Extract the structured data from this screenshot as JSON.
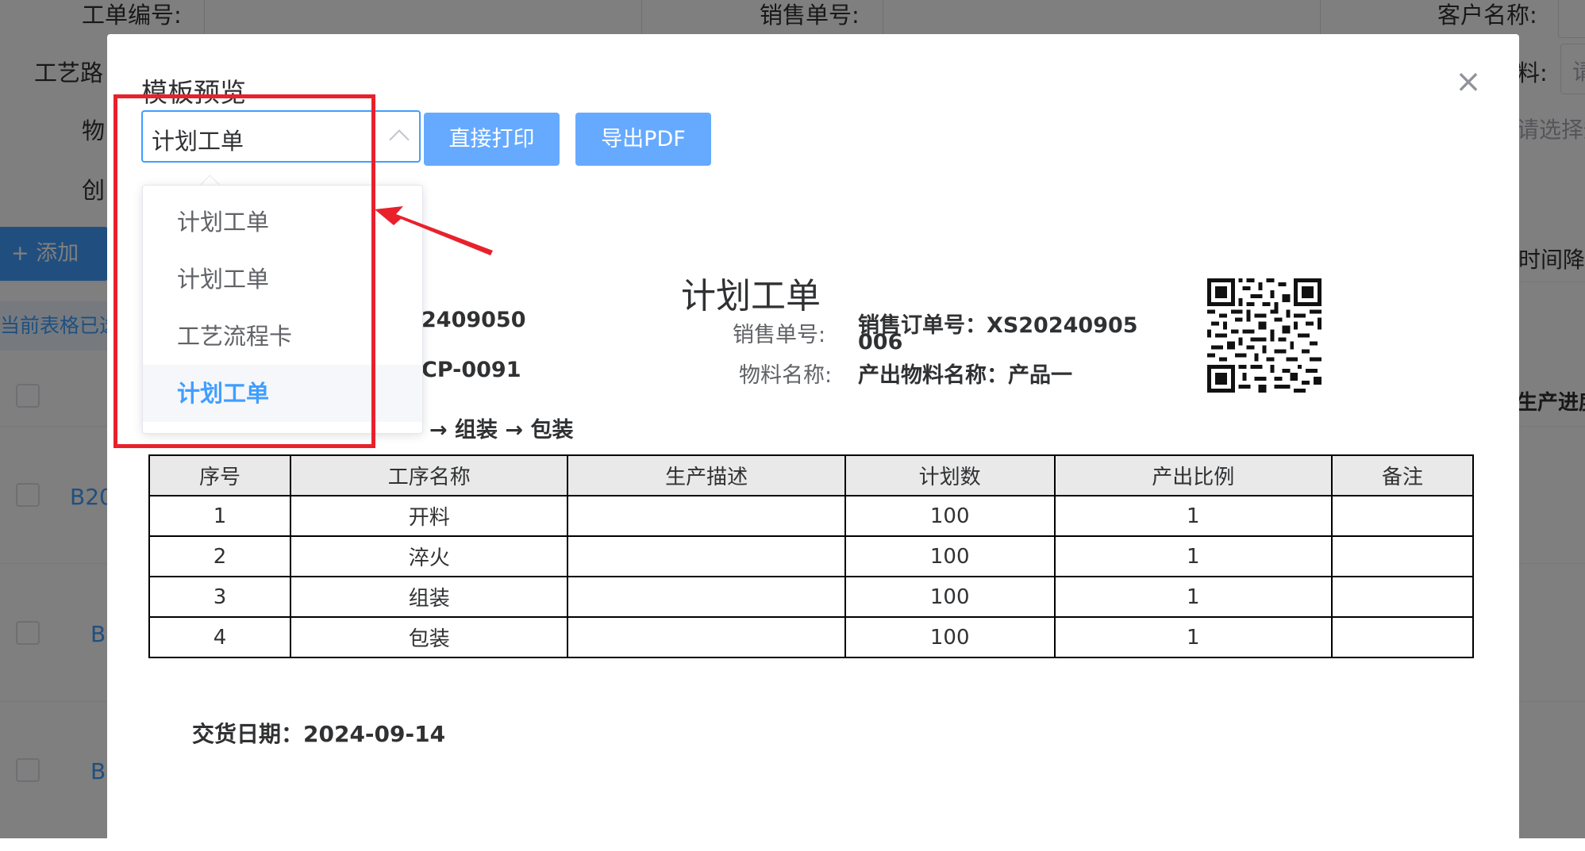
{
  "background": {
    "filters": {
      "order_no_label": "工单编号:",
      "sales_no_label": "销售单号:",
      "customer_label": "客户名称:",
      "route_label": "工艺路",
      "material_label": "物",
      "creator_label": "创",
      "material_right_label": "料:",
      "input_placeholder_right": "请",
      "select_spec_placeholder": "请选择规"
    },
    "add_button": "+ 添加",
    "table_tip": "当前表格已选",
    "time_col": "时间降",
    "progress_col": "生产进度",
    "rows": [
      "B20",
      "B",
      "B"
    ]
  },
  "dialog": {
    "title": "模板预览",
    "template_select_value": "计划工单",
    "print_button": "直接打印",
    "export_button": "导出PDF",
    "dropdown_options": [
      {
        "label": "计划工单",
        "selected": false
      },
      {
        "label": "计划工单",
        "selected": false
      },
      {
        "label": "工艺流程卡",
        "selected": false
      },
      {
        "label": "计划工单",
        "selected": true
      }
    ]
  },
  "preview": {
    "title": "计划工单",
    "order_no_fragment": "2409050",
    "product_code_fragment": "CP-0091",
    "sales_no_label": "销售单号:",
    "sales_no_value": "销售订单号：XS20240905",
    "sales_no_value_cont": "006",
    "material_label": "物料名称:",
    "material_value": "产出物料名称：产品一",
    "route_fragment": "→ 组装 → 包装",
    "table": {
      "headers": [
        "序号",
        "工序名称",
        "生产描述",
        "计划数",
        "产出比例",
        "备注"
      ],
      "rows": [
        [
          "1",
          "开料",
          "",
          "100",
          "1",
          ""
        ],
        [
          "2",
          "淬火",
          "",
          "100",
          "1",
          ""
        ],
        [
          "3",
          "组装",
          "",
          "100",
          "1",
          ""
        ],
        [
          "4",
          "包装",
          "",
          "100",
          "1",
          ""
        ]
      ]
    },
    "delivery": "交货日期：2024-09-14"
  },
  "colors": {
    "primary": "#409eff",
    "button": "#66aaff",
    "annotation": "#e8212b",
    "overlay": "rgba(0,0,0,0.5)"
  }
}
